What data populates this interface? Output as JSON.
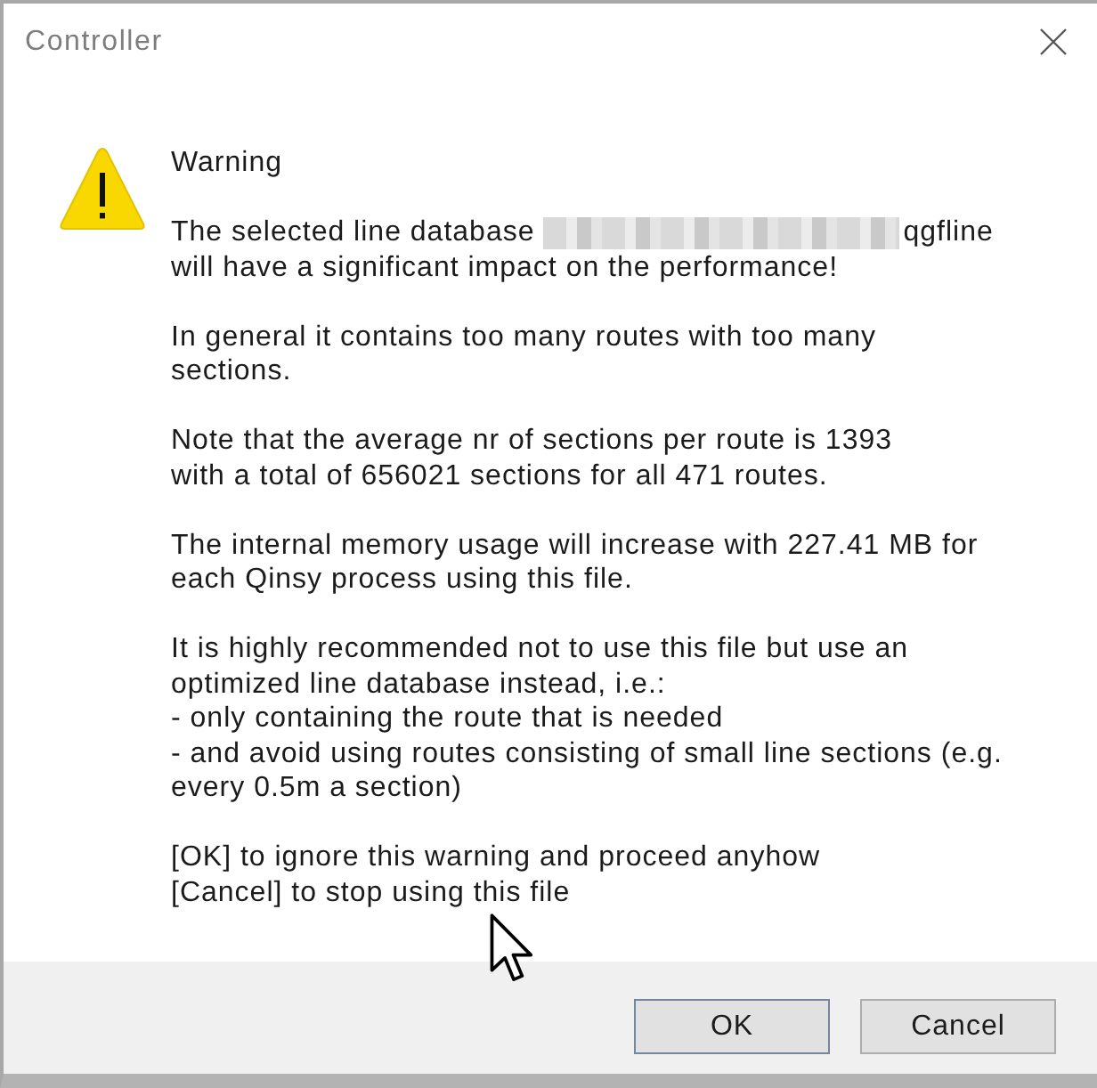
{
  "window": {
    "title": "Controller"
  },
  "message": {
    "heading": "Warning",
    "paragraphs": [
      {
        "kind": "redacted",
        "before": "The selected line database",
        "after": "qgfline",
        "lines": [
          "will have a significant impact on the performance!"
        ]
      },
      {
        "kind": "text",
        "lines": [
          "In general it contains too many routes with too many",
          "sections."
        ]
      },
      {
        "kind": "text",
        "lines": [
          "Note that the average nr of sections per route is 1393",
          "with a total of 656021 sections for all 471 routes."
        ]
      },
      {
        "kind": "text",
        "lines": [
          "The internal memory usage will increase with 227.41 MB for",
          "each Qinsy process using this file."
        ]
      },
      {
        "kind": "text",
        "lines": [
          "It is highly recommended not to use this file but use an",
          "optimized line database instead, i.e.:",
          "- only containing the route that is needed",
          "- and avoid using routes consisting of small line sections (e.g.",
          "every 0.5m a section)"
        ]
      },
      {
        "kind": "text",
        "lines": [
          "[OK] to ignore this warning and proceed anyhow",
          "[Cancel] to stop using this file"
        ]
      }
    ]
  },
  "buttons": [
    {
      "label": "OK",
      "default": true
    },
    {
      "label": "Cancel",
      "default": false
    }
  ]
}
